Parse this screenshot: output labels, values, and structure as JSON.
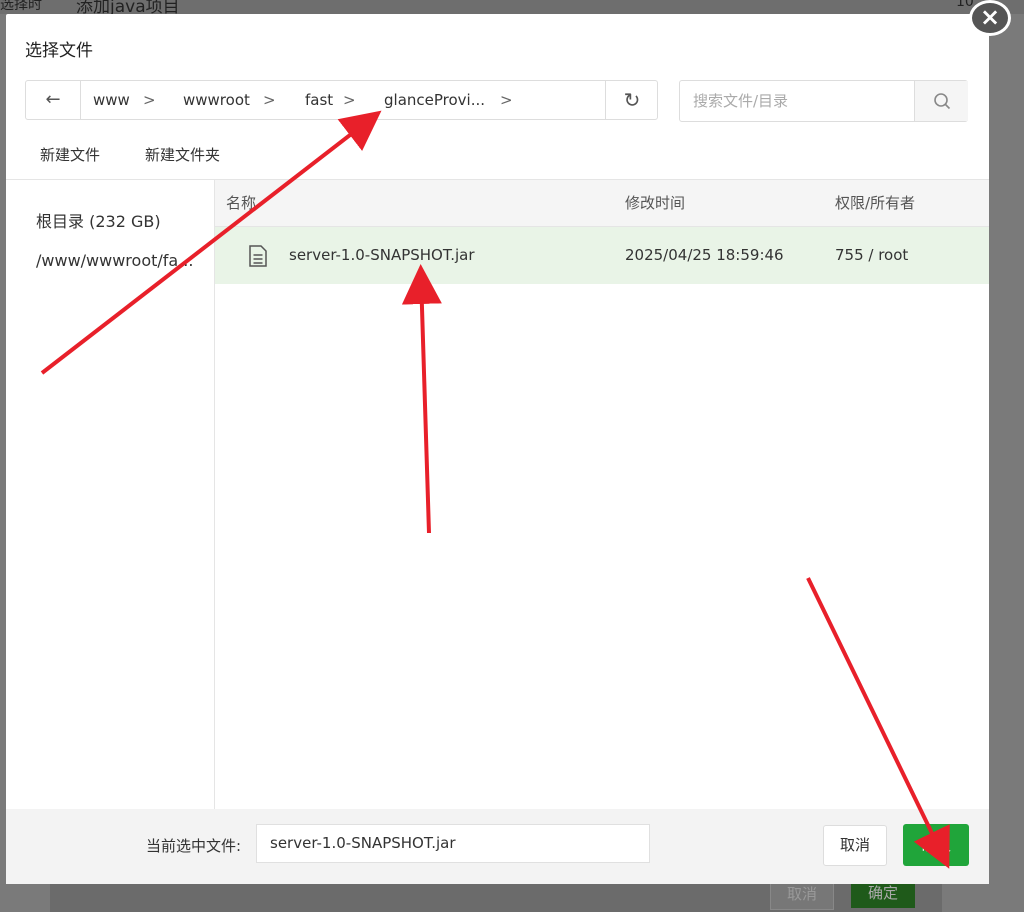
{
  "background": {
    "page_title": "添加java项目",
    "left_fragment": "选择时",
    "right_fragment": "10",
    "cancel_label": "取消",
    "ok_label": "确定"
  },
  "dialog": {
    "title": "选择文件",
    "close_label": "×"
  },
  "pathbar": {
    "back_icon": "←",
    "crumbs": [
      "www",
      "wwwroot",
      "fast",
      "glanceProvi..."
    ],
    "chevron": ">",
    "refresh_icon": "↻"
  },
  "search": {
    "placeholder": "搜索文件/目录",
    "icon": "search-icon"
  },
  "toolbar": {
    "new_file": "新建文件",
    "new_folder": "新建文件夹"
  },
  "sidebar": {
    "items": [
      "根目录 (232 GB)",
      "/www/wwwroot/fa..."
    ]
  },
  "table": {
    "columns": [
      "名称",
      "修改时间",
      "权限/所有者"
    ],
    "rows": [
      {
        "name": "server-1.0-SNAPSHOT.jar",
        "modified": "2025/04/25 18:59:46",
        "perm": "755 / root"
      }
    ]
  },
  "footer": {
    "label": "当前选中文件:",
    "selected_file": "server-1.0-SNAPSHOT.jar",
    "cancel_label": "取消",
    "confirm_label": "确认"
  },
  "colors": {
    "accent": "#20a53a",
    "selected_row": "#e9f4e7",
    "annotation": "#e8202a"
  }
}
